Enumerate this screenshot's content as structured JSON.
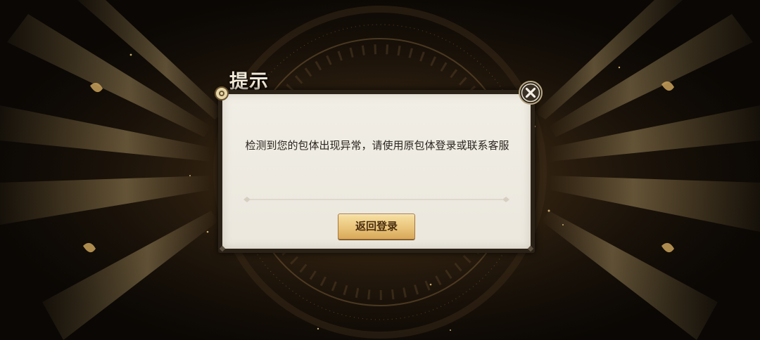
{
  "dialog": {
    "title": "提示",
    "message": "检测到您的包体出现异常，请使用原包体登录或联系客服",
    "return_button_label": "返回登录"
  },
  "icons": {
    "close": "close-icon",
    "badge": "gear-badge-icon"
  },
  "colors": {
    "panel_background": "#efebe2",
    "button_gold": "#e9c47a",
    "button_text": "#4a2e10",
    "title_text": "#f3ead8",
    "message_text": "#2b2620"
  }
}
